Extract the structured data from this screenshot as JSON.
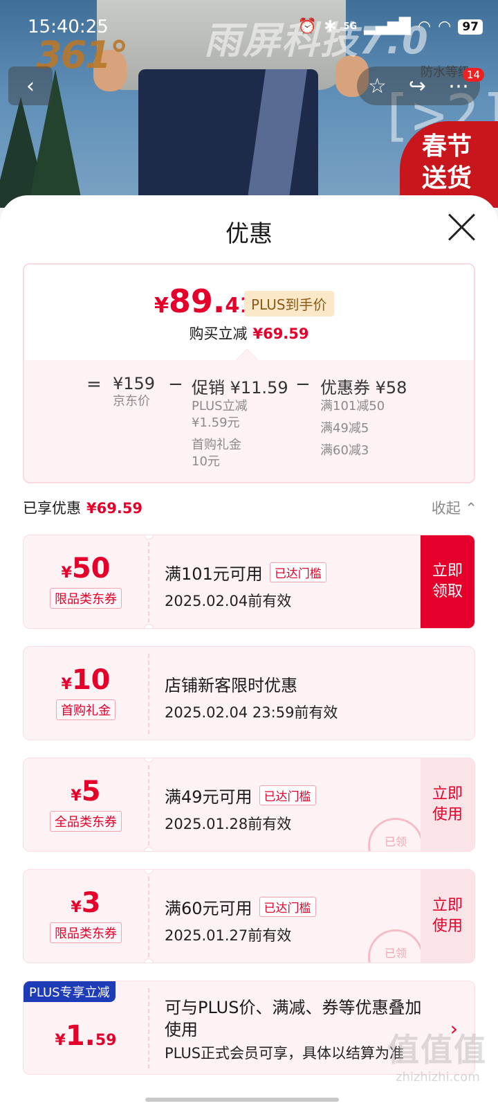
{
  "status_bar": {
    "time": "15:40:25",
    "network": "5G",
    "battery": "97"
  },
  "banner": {
    "brand": "361°",
    "watermark_title": "雨屏科技7.0",
    "watermark_sub": "防水等级",
    "promo": "春节送货",
    "promo_line1": "春节",
    "promo_line2": "送货",
    "cart_count": "14"
  },
  "sheet": {
    "title": "优惠"
  },
  "price": {
    "yen": "¥",
    "int": "89.",
    "dec": "41",
    "plus_tag": "PLUS到手价",
    "save_label": "购买立减",
    "save_amount": "¥69.59"
  },
  "breakdown": {
    "equals": "=",
    "minus": "−",
    "jd_price": "¥159",
    "jd_label": "京东价",
    "promo_label": "促销 ¥11.59",
    "promo_items": [
      "PLUS立减",
      "¥1.59元",
      "首购礼金",
      "10元"
    ],
    "coupon_label": "优惠券 ¥58",
    "coupon_items": [
      "满101减50",
      "满49减5",
      "满60减3"
    ]
  },
  "enjoyed": {
    "label": "已享优惠",
    "amount": "¥69.59",
    "collapse": "收起 ⌃"
  },
  "coupons": [
    {
      "yen": "¥",
      "amount": "50",
      "type": "限品类东券",
      "title": "满101元可用",
      "badge": "已达门槛",
      "date": "2025.02.04前有效",
      "action": "立即领取"
    },
    {
      "yen": "¥",
      "amount": "10",
      "type": "首购礼金",
      "title": "店铺新客限时优惠",
      "date": "2025.02.04 23:59前有效"
    },
    {
      "yen": "¥",
      "amount": "5",
      "type": "全品类东券",
      "title": "满49元可用",
      "badge": "已达门槛",
      "date": "2025.01.28前有效",
      "action": "立即使用",
      "stamp": "已领"
    },
    {
      "yen": "¥",
      "amount": "3",
      "type": "限品类东券",
      "title": "满60元可用",
      "badge": "已达门槛",
      "date": "2025.01.27前有效",
      "action": "立即使用",
      "stamp": "已领"
    }
  ],
  "plus_card": {
    "badge": "PLUS专享立减",
    "yen": "¥",
    "int": "1.",
    "dec": "59",
    "title": "可与PLUS价、满减、券等优惠叠加使用",
    "desc": "PLUS正式会员可享，具体以结算为准"
  },
  "watermark": {
    "logo": "值值值",
    "url": "zhizhizhi.com"
  },
  "colors": {
    "accent": "#e4002b",
    "plus_blue": "#1f3cb8",
    "coupon_bg": "#fdf2f4"
  }
}
